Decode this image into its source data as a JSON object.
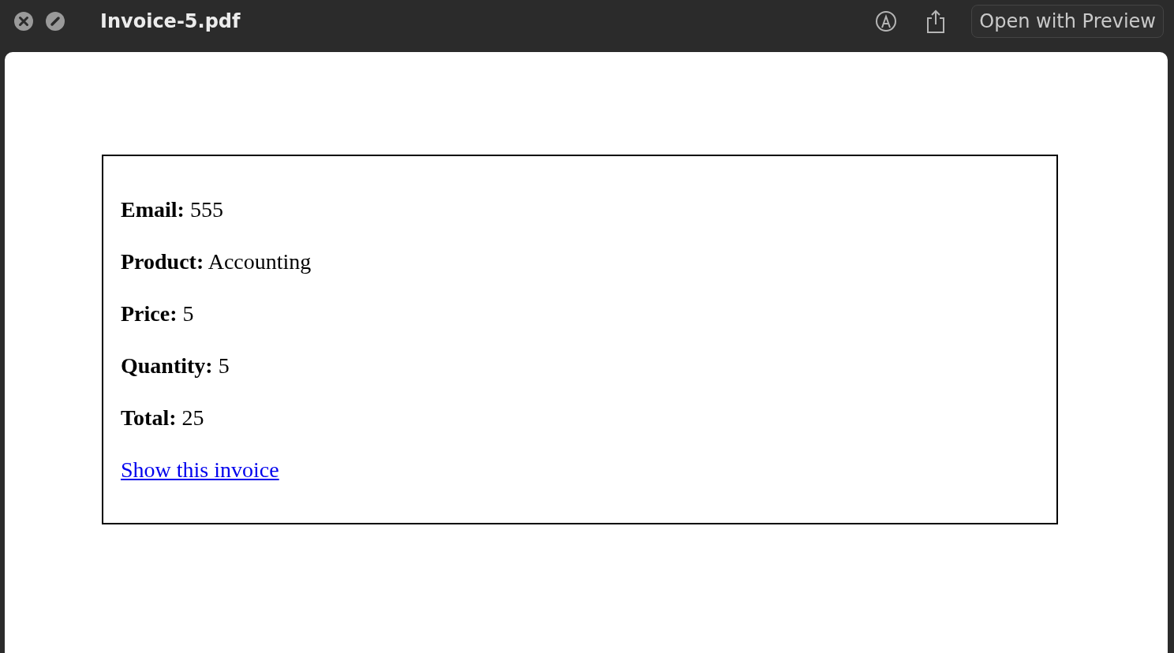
{
  "window": {
    "title": "Invoice-5.pdf",
    "action_button": "Open with Preview"
  },
  "invoice": {
    "fields": [
      {
        "label": "Email:",
        "value": "555"
      },
      {
        "label": "Product:",
        "value": "Accounting"
      },
      {
        "label": "Price:",
        "value": "5"
      },
      {
        "label": "Quantity:",
        "value": "5"
      },
      {
        "label": "Total:",
        "value": "25"
      }
    ],
    "link": "Show this invoice"
  }
}
